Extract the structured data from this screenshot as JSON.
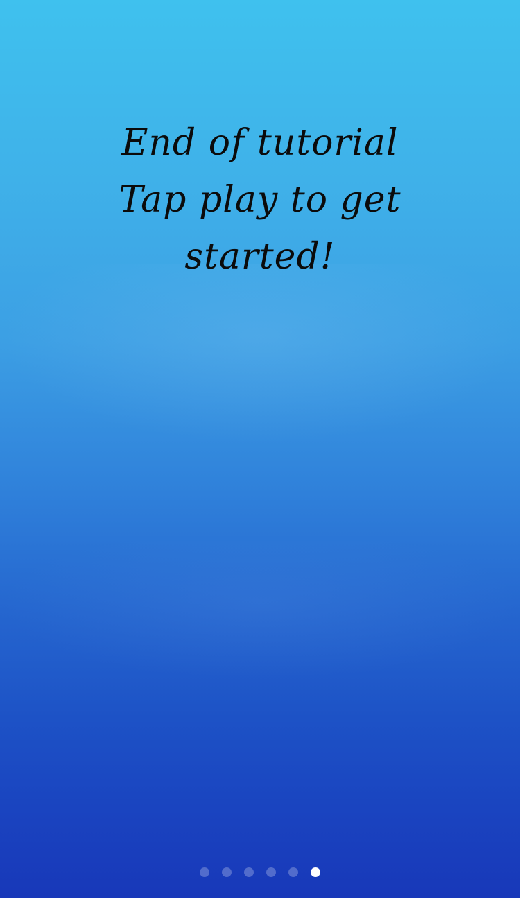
{
  "tutorial": {
    "lines": [
      "End of tutorial",
      "Tap play to get",
      "started!"
    ]
  },
  "pager": {
    "total_pages": 6,
    "current_page": 6
  },
  "colors": {
    "background_top": "#3fc1ee",
    "background_bottom": "#1838b9",
    "text": "#0b0b0b",
    "dot_inactive": "rgba(255,255,255,0.25)",
    "dot_active": "#ffffff"
  }
}
